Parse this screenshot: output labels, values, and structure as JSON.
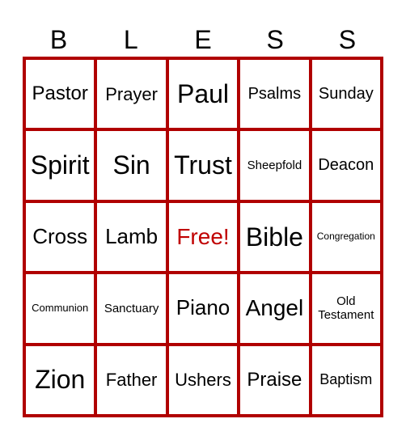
{
  "header": {
    "letters": [
      "B",
      "L",
      "E",
      "S",
      "S"
    ]
  },
  "colors": {
    "grid": "#b00000",
    "free_text": "#c00000"
  },
  "board": {
    "cells": [
      {
        "text": "Pastor",
        "size": 24
      },
      {
        "text": "Prayer",
        "size": 22
      },
      {
        "text": "Paul",
        "size": 32
      },
      {
        "text": "Psalms",
        "size": 20
      },
      {
        "text": "Sunday",
        "size": 20
      },
      {
        "text": "Spirit",
        "size": 32
      },
      {
        "text": "Sin",
        "size": 32
      },
      {
        "text": "Trust",
        "size": 32
      },
      {
        "text": "Sheepfold",
        "size": 15
      },
      {
        "text": "Deacon",
        "size": 20
      },
      {
        "text": "Cross",
        "size": 26
      },
      {
        "text": "Lamb",
        "size": 26
      },
      {
        "text": "Free!",
        "size": 28,
        "free": true
      },
      {
        "text": "Bible",
        "size": 32
      },
      {
        "text": "Congregation",
        "size": 12
      },
      {
        "text": "Communion",
        "size": 13
      },
      {
        "text": "Sanctuary",
        "size": 15
      },
      {
        "text": "Piano",
        "size": 26
      },
      {
        "text": "Angel",
        "size": 28
      },
      {
        "text": "Old Testament",
        "size": 15
      },
      {
        "text": "Zion",
        "size": 32
      },
      {
        "text": "Father",
        "size": 22
      },
      {
        "text": "Ushers",
        "size": 22
      },
      {
        "text": "Praise",
        "size": 24
      },
      {
        "text": "Baptism",
        "size": 18
      }
    ]
  }
}
